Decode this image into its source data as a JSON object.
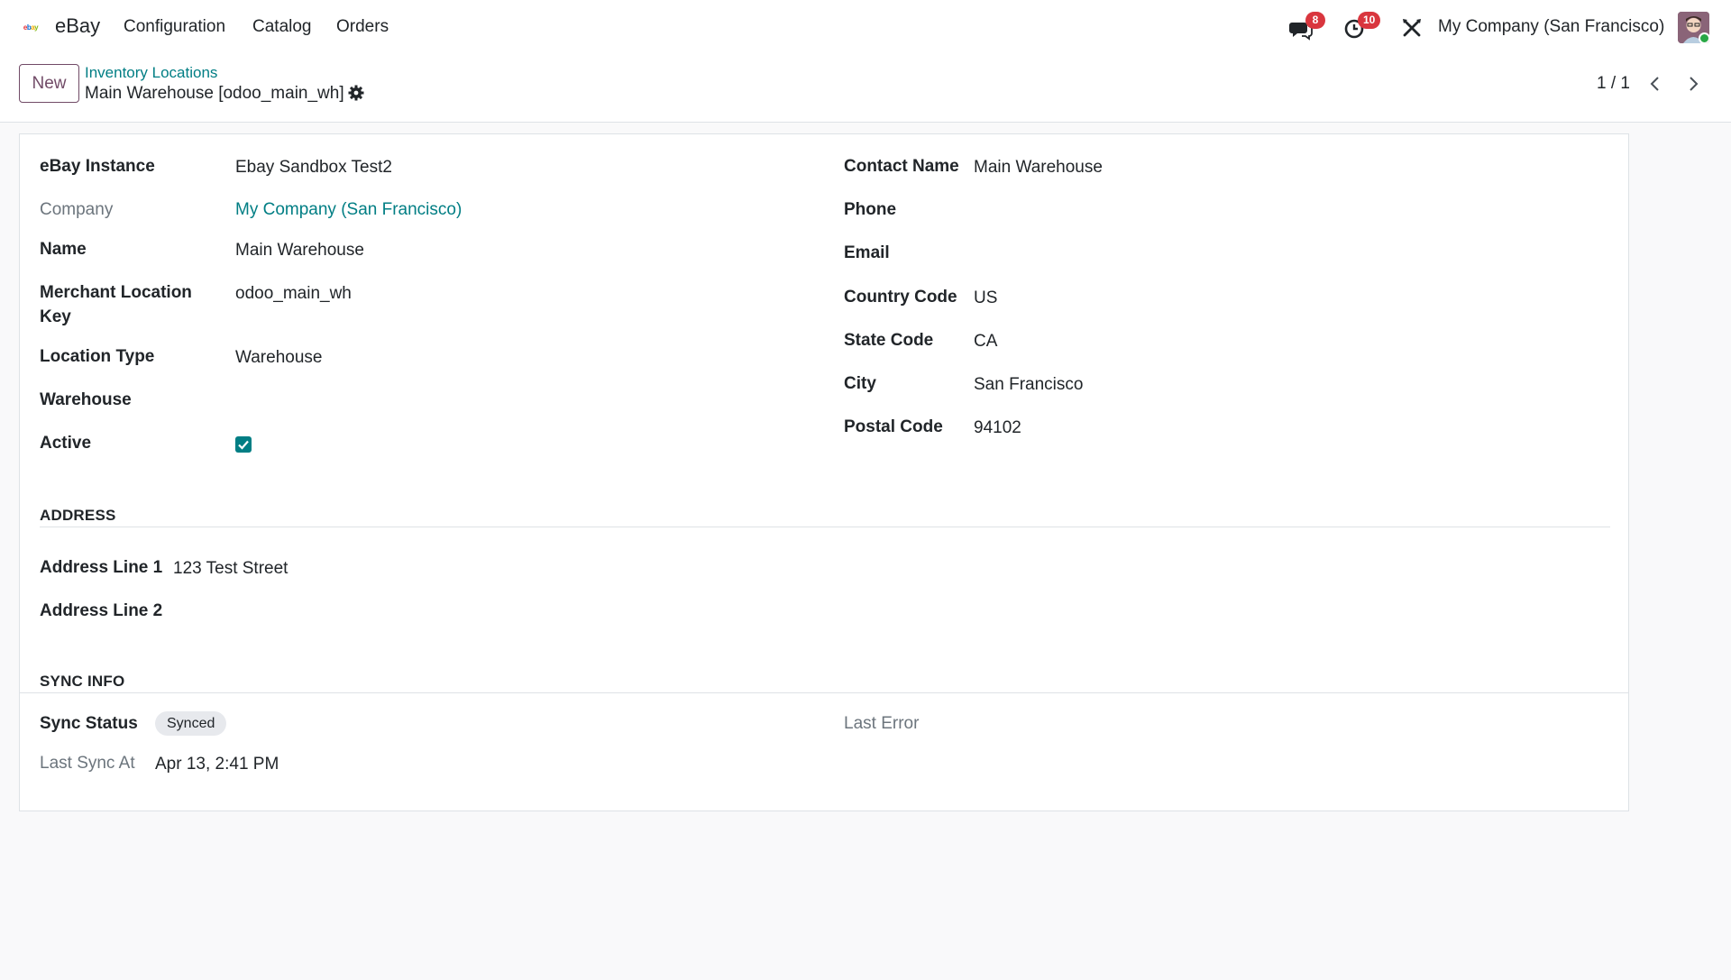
{
  "navbar": {
    "logo_letters": [
      "e",
      "b",
      "a",
      "y"
    ],
    "app_name": "eBay",
    "menu": [
      "Configuration",
      "Catalog",
      "Orders"
    ],
    "messages_badge": "8",
    "activities_badge": "10",
    "company": "My Company (San Francisco)"
  },
  "control_panel": {
    "new_label": "New",
    "breadcrumb": "Inventory Locations",
    "record_title": "Main Warehouse [odoo_main_wh]",
    "pager": "1 / 1"
  },
  "form": {
    "left": {
      "ebay_instance": {
        "label": "eBay Instance",
        "value": "Ebay Sandbox Test2"
      },
      "company": {
        "label": "Company",
        "value": "My Company (San Francisco)"
      },
      "name": {
        "label": "Name",
        "value": "Main Warehouse"
      },
      "merchant_location_key": {
        "label_line1": "Merchant Location",
        "label_line2": "Key",
        "value": "odoo_main_wh"
      },
      "location_type": {
        "label": "Location Type",
        "value": "Warehouse"
      },
      "warehouse": {
        "label": "Warehouse",
        "value": ""
      },
      "active": {
        "label": "Active",
        "checked": true
      }
    },
    "right": {
      "contact_name": {
        "label": "Contact Name",
        "value": "Main Warehouse"
      },
      "phone": {
        "label": "Phone",
        "value": ""
      },
      "email": {
        "label": "Email",
        "value": ""
      },
      "country_code": {
        "label": "Country Code",
        "value": "US"
      },
      "state_code": {
        "label": "State Code",
        "value": "CA"
      },
      "city": {
        "label": "City",
        "value": "San Francisco"
      },
      "postal_code": {
        "label": "Postal Code",
        "value": "94102"
      }
    },
    "address": {
      "title": "ADDRESS",
      "line1": {
        "label": "Address Line 1",
        "value": "123 Test Street"
      },
      "line2": {
        "label": "Address Line 2",
        "value": ""
      }
    },
    "sync_info": {
      "title": "SYNC INFO",
      "sync_status": {
        "label": "Sync Status",
        "value": "Synced"
      },
      "last_sync_at": {
        "label": "Last Sync At",
        "value": "Apr 13, 2:41 PM"
      },
      "last_error": {
        "label": "Last Error",
        "value": ""
      }
    }
  },
  "colors": {
    "primary": "#714b67",
    "link": "#017e84",
    "badge": "#d9363e"
  }
}
